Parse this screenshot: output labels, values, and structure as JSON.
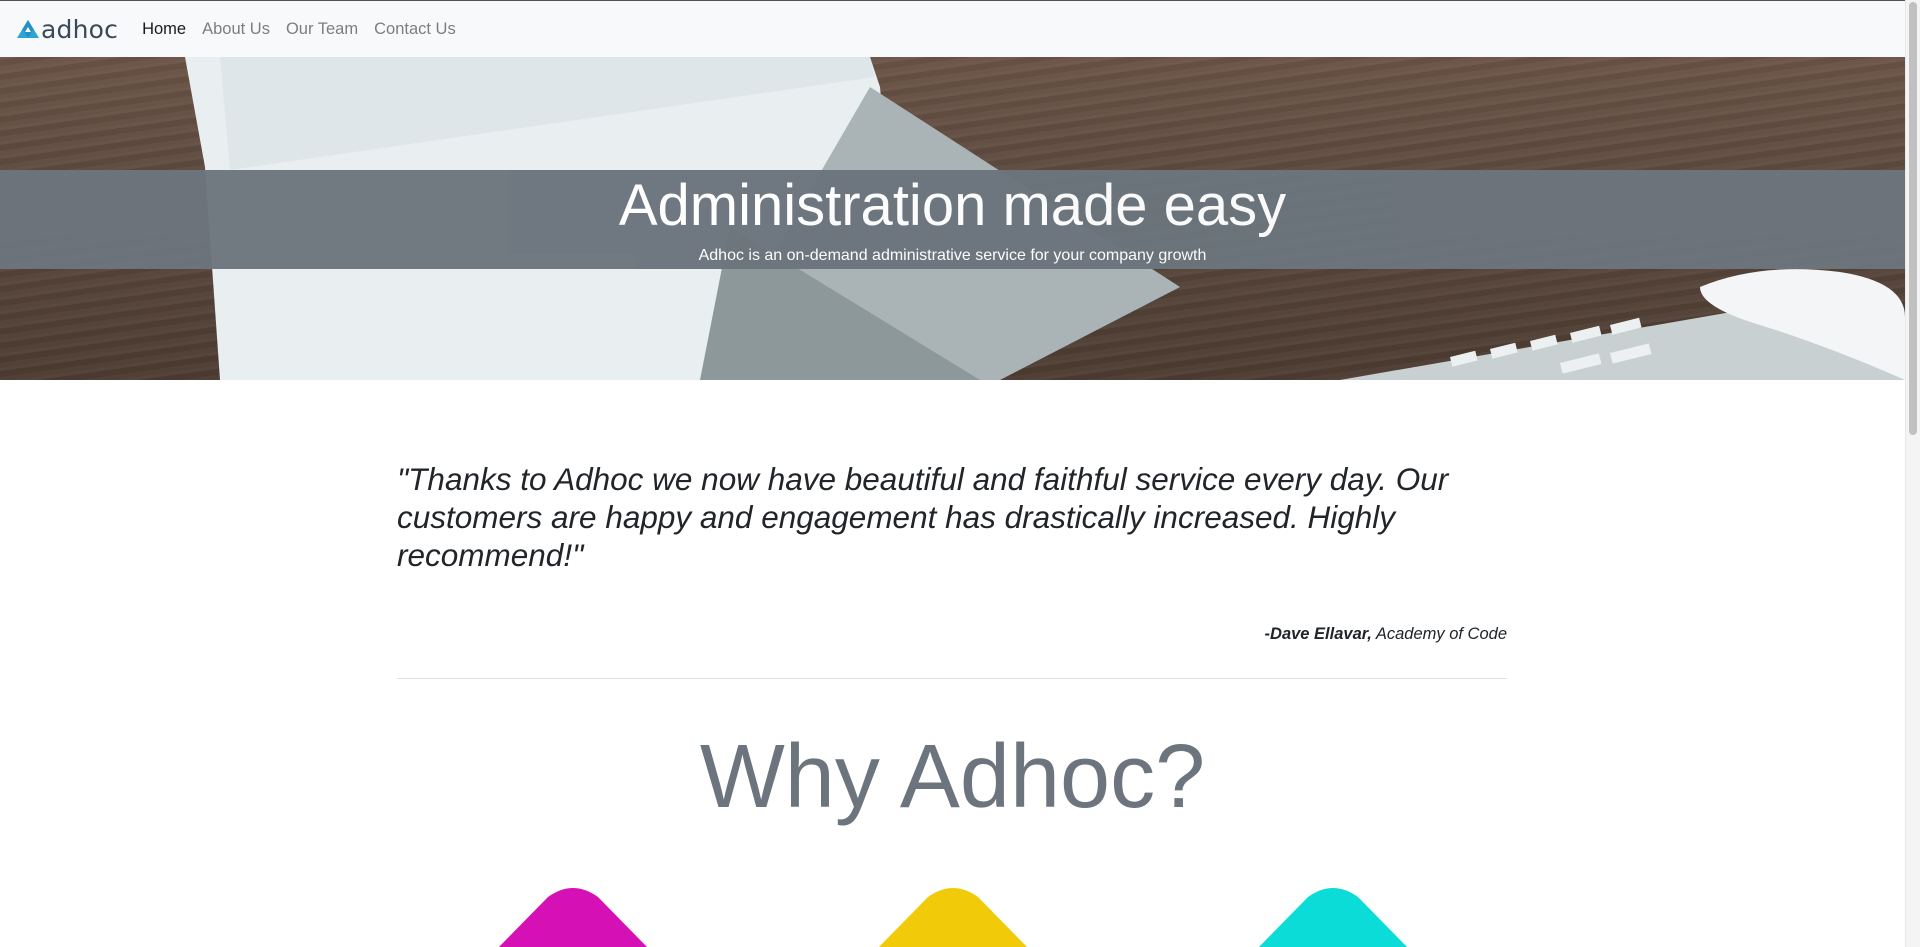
{
  "brand": {
    "name": "adhoc",
    "logo_icon": "triangle-logo-icon",
    "color": "#2aa5d6"
  },
  "nav": {
    "items": [
      {
        "label": "Home",
        "active": true
      },
      {
        "label": "About Us",
        "active": false
      },
      {
        "label": "Our Team",
        "active": false
      },
      {
        "label": "Contact Us",
        "active": false
      }
    ]
  },
  "hero": {
    "title": "Administration made easy",
    "subtitle": "Adhoc is an on-demand administrative service for your company growth",
    "band_color": "#6c757d"
  },
  "testimonial": {
    "quote": "\"Thanks to Adhoc we now have beautiful and faithful service every day. Our customers are happy and engagement has drastically increased. Highly recommend!\"",
    "author": "-Dave Ellavar,",
    "company": "Academy of Code"
  },
  "why": {
    "heading": "Why Adhoc?",
    "shape_colors": [
      "#d511b5",
      "#f1cb0a",
      "#0cdcd8"
    ]
  }
}
